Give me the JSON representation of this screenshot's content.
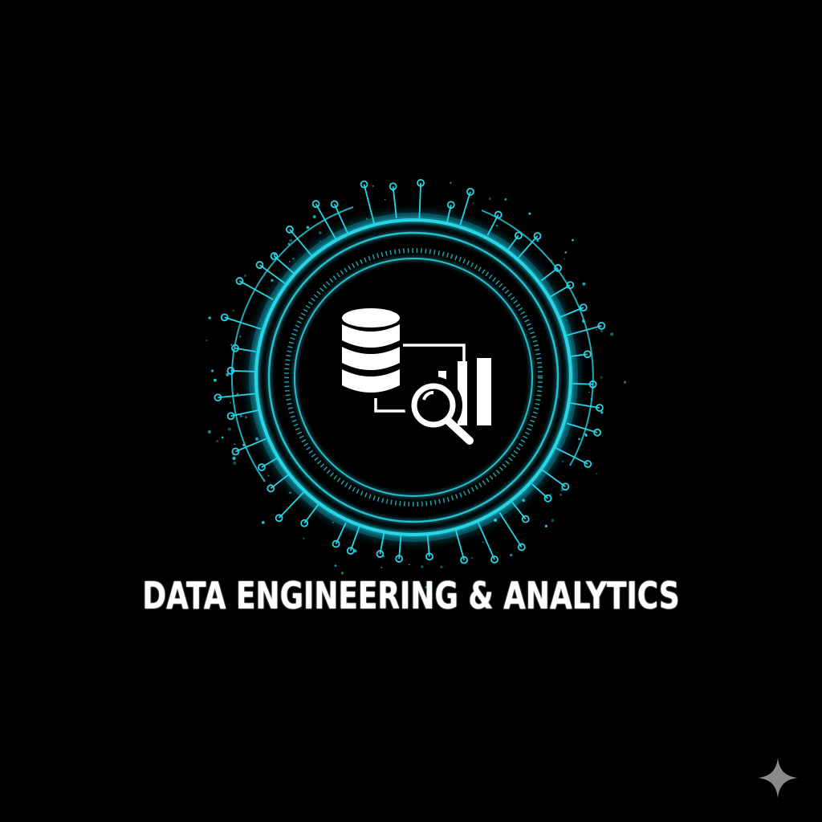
{
  "logo": {
    "title": "DATA ENGINEERING & ANALYTICS",
    "icons": [
      "database-icon",
      "magnifier-icon",
      "bar-chart-icon",
      "connector-icon"
    ],
    "ring_icon": "circuit-ring"
  },
  "watermark": {
    "icon": "sparkle-icon"
  },
  "colors": {
    "background": "#000000",
    "accent": "#26d6e6",
    "accent_glow": "#0fb7d0",
    "text": "#ffffff",
    "watermark": "#8a8a8a"
  }
}
